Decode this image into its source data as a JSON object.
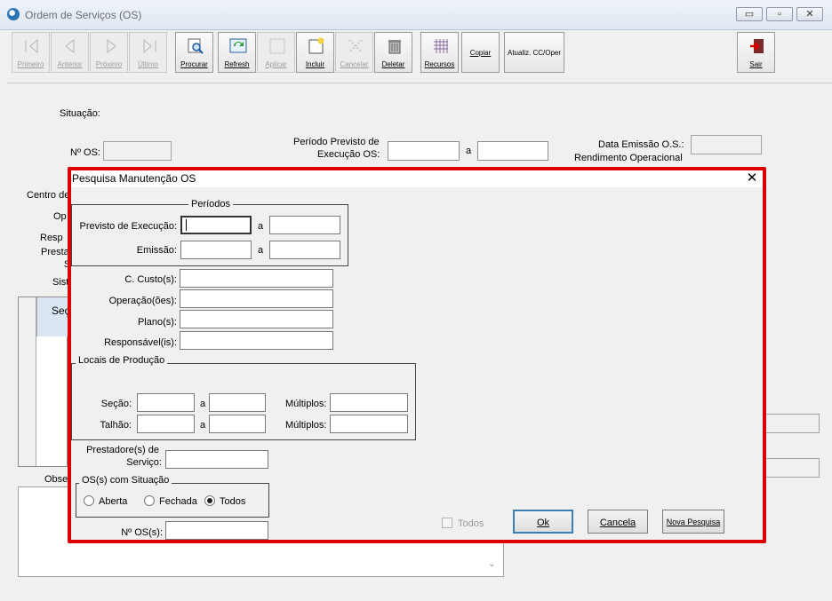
{
  "window": {
    "title": "Ordem de Serviços (OS)",
    "minimize": "▭",
    "maximize": "▫",
    "close": "✕"
  },
  "toolbar": {
    "buttons": [
      {
        "label": "Primeiro",
        "icon": "first-record-icon"
      },
      {
        "label": "Anterior",
        "icon": "previous-record-icon"
      },
      {
        "label": "Próximo",
        "icon": "next-record-icon"
      },
      {
        "label": "Último",
        "icon": "last-record-icon"
      },
      {
        "label": "Procurar",
        "icon": "search-icon"
      },
      {
        "label": "Refresh",
        "icon": "refresh-icon"
      },
      {
        "label": "Aplicar",
        "icon": "apply-icon"
      },
      {
        "label": "Incluir",
        "icon": "add-icon"
      },
      {
        "label": "Cancelar",
        "icon": "cancel-icon"
      },
      {
        "label": "Deletar",
        "icon": "trash-icon"
      },
      {
        "label": "Recursos",
        "icon": "grid-icon"
      },
      {
        "label": "Copiar",
        "icon": ""
      },
      {
        "label": "Atualiz. CC/Oper",
        "icon": ""
      },
      {
        "label": "Sair",
        "icon": "exit-icon"
      }
    ]
  },
  "form": {
    "situacao": "Situação:",
    "no_os": "Nº OS:",
    "periodo_previsto_1": "Período Previsto de",
    "periodo_previsto_2": "Execução OS:",
    "a": "a",
    "data_emissao": "Data Emissão O.S.:",
    "rendimento": "Rendimento Operacional",
    "centro": "Centro de",
    "op": "Op",
    "resp": "Resp",
    "presta": "Presta",
    "s": "S",
    "sist": "Sist",
    "grid_header": "Seç",
    "obs": "Obse"
  },
  "dialog": {
    "title": "Pesquisa Manutenção OS",
    "close": "✕",
    "periodos": "Períodos",
    "previsto": "Previsto de Execução:",
    "emissao": "Emissão:",
    "a": "a",
    "c_custo": "C. Custo(s):",
    "operacoes": "Operação(ões):",
    "plano": "Plano(s):",
    "responsavel": "Responsável(is):",
    "locais": "Locais de Produção",
    "secao": "Seção:",
    "talhao": "Talhão:",
    "multiplos": "Múltiplos:",
    "prestadores_1": "Prestadore(s) de",
    "prestadores_2": "Serviço:",
    "situacao_group": "OS(s) com Situação",
    "radio_aberta": "Aberta",
    "radio_fechada": "Fechada",
    "radio_todos": "Todos",
    "selected_situacao": "Todos",
    "no_os": "Nº OS(s):",
    "todos_check": "Todos",
    "ok": "Ok",
    "cancela": "Cancela",
    "nova_pesquisa": "Nova Pesquisa"
  }
}
